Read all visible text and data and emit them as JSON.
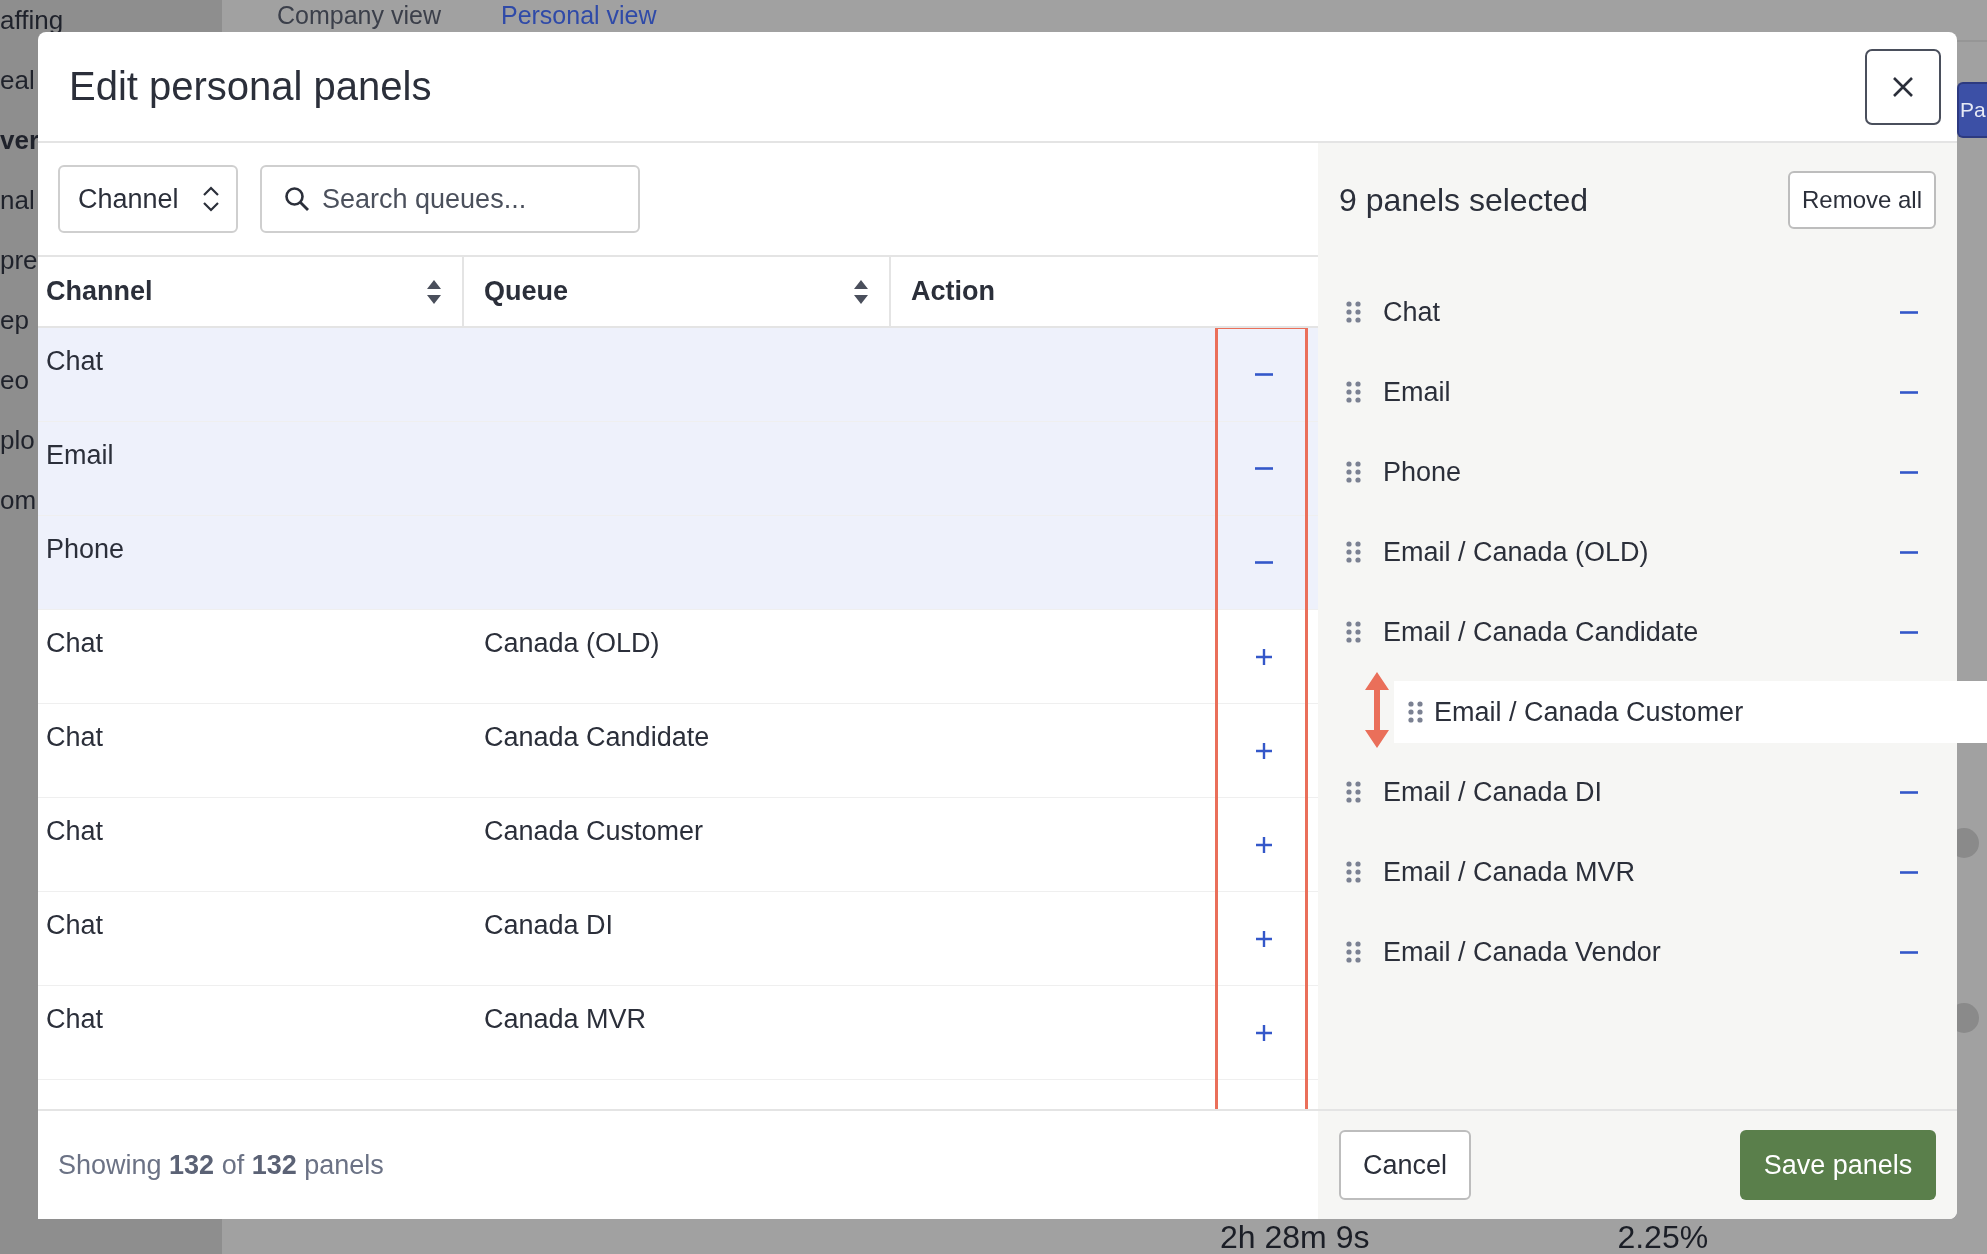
{
  "background": {
    "sidebar_items": [
      {
        "label": "affing",
        "bold": false
      },
      {
        "label": "eal",
        "bold": false
      },
      {
        "label": "ver",
        "bold": true
      },
      {
        "label": "nal",
        "bold": false
      },
      {
        "label": "pre",
        "bold": false
      },
      {
        "label": "ep",
        "bold": false
      },
      {
        "label": "eo",
        "bold": false
      },
      {
        "label": "plo",
        "bold": false
      },
      {
        "label": "om",
        "bold": false
      }
    ],
    "view_tabs": [
      {
        "label": "Company view",
        "selected": false
      },
      {
        "label": "Personal view",
        "selected": true
      }
    ],
    "top_right_button": "Pa",
    "stats": [
      "2h 28m 9s",
      "2.25%"
    ]
  },
  "modal": {
    "title": "Edit personal panels",
    "filter": {
      "select": "Channel",
      "search_placeholder": "Search queues..."
    },
    "table": {
      "columns": [
        {
          "label": "Channel",
          "sortable": true
        },
        {
          "label": "Queue",
          "sortable": true
        },
        {
          "label": "Action",
          "sortable": false
        }
      ],
      "action_column_highlighted": true,
      "rows": [
        {
          "channel": "Chat",
          "queue": "",
          "selected": true
        },
        {
          "channel": "Email",
          "queue": "",
          "selected": true
        },
        {
          "channel": "Phone",
          "queue": "",
          "selected": true
        },
        {
          "channel": "Chat",
          "queue": "Canada (OLD)",
          "selected": false
        },
        {
          "channel": "Chat",
          "queue": "Canada Candidate",
          "selected": false
        },
        {
          "channel": "Chat",
          "queue": "Canada Customer",
          "selected": false
        },
        {
          "channel": "Chat",
          "queue": "Canada DI",
          "selected": false
        },
        {
          "channel": "Chat",
          "queue": "Canada MVR",
          "selected": false
        }
      ]
    },
    "footer_text": "Showing **132** of **132** panels",
    "selected_panel": {
      "heading": "9 panels selected",
      "remove_all": "Remove all",
      "items": [
        {
          "label": "Chat",
          "kind": "item"
        },
        {
          "label": "Email",
          "kind": "item"
        },
        {
          "label": "Phone",
          "kind": "item"
        },
        {
          "label": "Email / Canada (OLD)",
          "kind": "item"
        },
        {
          "label": "Email / Canada Candidate",
          "kind": "item"
        },
        {
          "label": "Email / Canada Customer",
          "kind": "dragging"
        },
        {
          "label": "Email / Canada DI",
          "kind": "item"
        },
        {
          "label": "Email / Canada MVR",
          "kind": "item"
        },
        {
          "label": "Email / Canada Vendor",
          "kind": "item"
        }
      ]
    },
    "buttons": {
      "cancel": "Cancel",
      "save": "Save panels"
    }
  }
}
